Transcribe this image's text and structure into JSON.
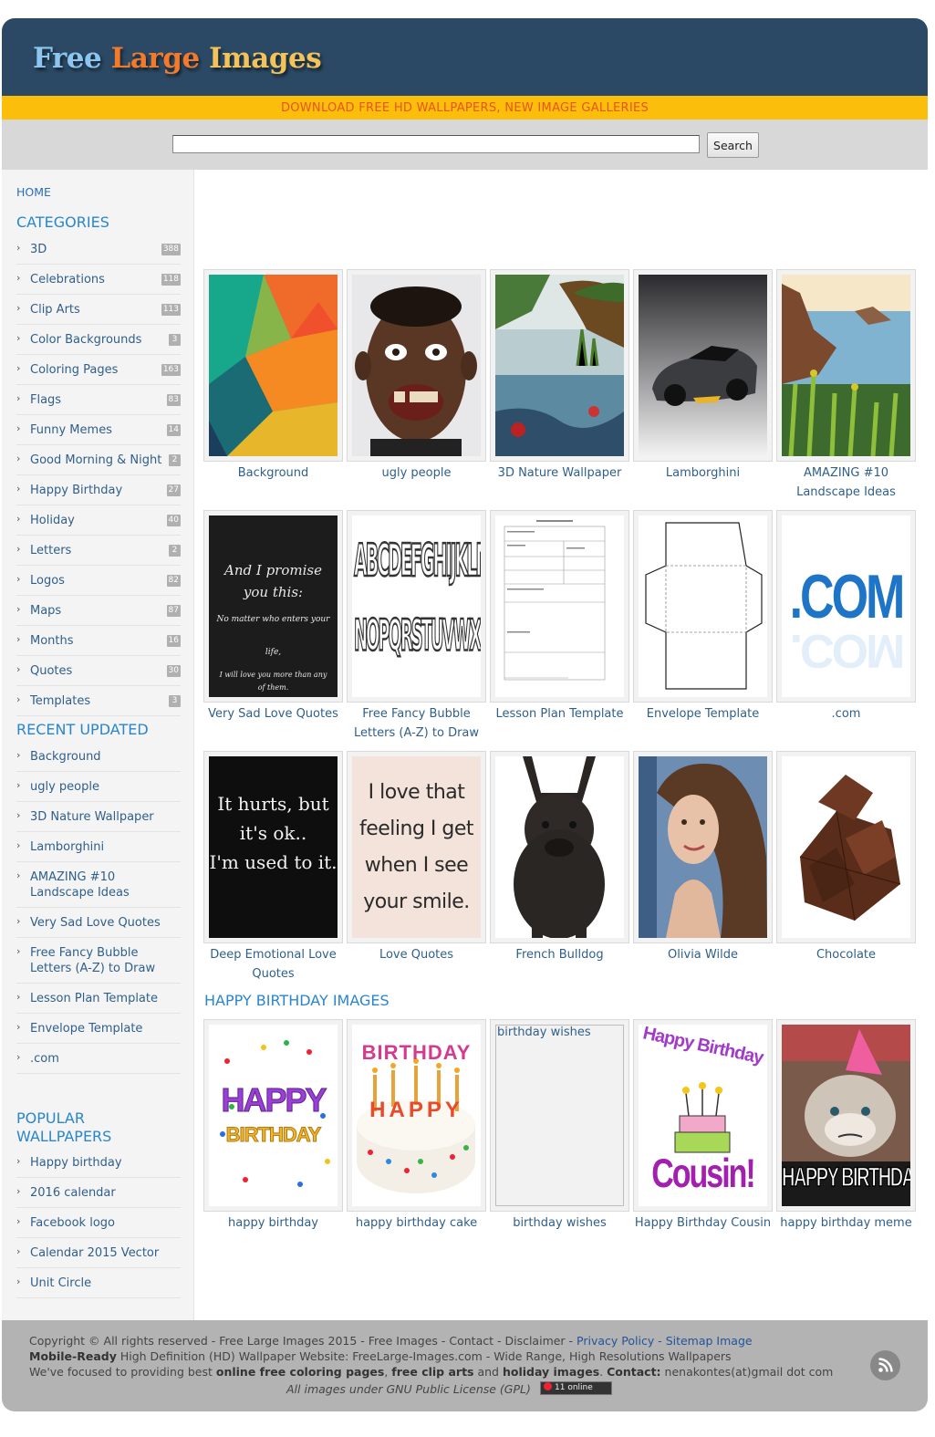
{
  "header": {
    "logo_word1": "Free",
    "logo_word2": "Large",
    "logo_word3": "Images",
    "tagline": "DOWNLOAD FREE HD WALLPAPERS, NEW IMAGE GALLERIES"
  },
  "search": {
    "value": "",
    "button_label": "Search"
  },
  "sidebar": {
    "home_label": "HOME",
    "categories_heading": "CATEGORIES",
    "categories": [
      {
        "label": "3D",
        "count": "388"
      },
      {
        "label": "Celebrations",
        "count": "118"
      },
      {
        "label": "Clip Arts",
        "count": "113"
      },
      {
        "label": "Color Backgrounds",
        "count": "3"
      },
      {
        "label": "Coloring Pages",
        "count": "163"
      },
      {
        "label": "Flags",
        "count": "83"
      },
      {
        "label": "Funny Memes",
        "count": "14"
      },
      {
        "label": "Good Morning & Night",
        "count": "2"
      },
      {
        "label": "Happy Birthday",
        "count": "27"
      },
      {
        "label": "Holiday",
        "count": "40"
      },
      {
        "label": "Letters",
        "count": "2"
      },
      {
        "label": "Logos",
        "count": "82"
      },
      {
        "label": "Maps",
        "count": "87"
      },
      {
        "label": "Months",
        "count": "16"
      },
      {
        "label": "Quotes",
        "count": "30"
      },
      {
        "label": "Templates",
        "count": "3"
      }
    ],
    "recent_heading": "RECENT UPDATED",
    "recent": [
      "Background",
      "ugly people",
      "3D Nature Wallpaper",
      "Lamborghini",
      "AMAZING #10 Landscape Ideas",
      "Very Sad Love Quotes",
      "Free Fancy Bubble Letters (A-Z) to Draw",
      "Lesson Plan Template",
      "Envelope Template",
      ".com"
    ],
    "popular_heading": "POPULAR WALLPAPERS",
    "popular": [
      "Happy birthday",
      "2016 calendar",
      "Facebook logo",
      "Calendar 2015 Vector",
      "Unit Circle"
    ]
  },
  "gallery": {
    "row1": [
      "Background",
      "ugly people",
      "3D Nature Wallpaper",
      "Lamborghini",
      "AMAZING #10 Landscape Ideas"
    ],
    "row2": [
      "Very Sad Love Quotes",
      "Free Fancy Bubble Letters (A-Z) to Draw",
      "Lesson Plan Template",
      "Envelope Template",
      ".com"
    ],
    "row3": [
      "Deep Emotional Love Quotes",
      "Love Quotes",
      "French Bulldog",
      "Olivia Wilde",
      "Chocolate"
    ],
    "quote1": [
      "And I promise you this:",
      "No matter who enters your life,",
      "I will love you more than any of them."
    ],
    "quote2": [
      "It hurts, but",
      "it's ok..",
      "I'm used to it."
    ],
    "quote3": [
      "I love that",
      "feeling I get",
      "when I see",
      "your smile."
    ],
    "alphabet1": "ABCDEFGHIJKLM",
    "alphabet2": "NOPQRSTUVWXYZ",
    "dotcom": ".COM"
  },
  "birthday": {
    "heading": "HAPPY BIRTHDAY IMAGES",
    "items": [
      "happy birthday",
      "happy birthday cake",
      "birthday wishes",
      "Happy Birthday Cousin",
      "happy birthday meme"
    ],
    "alt_text": "birthday wishes",
    "happy": "HAPPY",
    "birthday_word": "BIRTHDAY",
    "cousin_top": "Happy Birthday",
    "cousin_bottom": "Cousin!",
    "meme_text": "HAPPY BIRTHDAY"
  },
  "footer": {
    "line1": "Copyright © All rights reserved - Free Large Images 2015 - Free Images - Contact - Disclaimer - ",
    "privacy": "Privacy Policy",
    "sep": " - ",
    "sitemap": "Sitemap Image",
    "line2_bold": "Mobile-Ready",
    "line2_rest": " High Definition (HD) Wallpaper Website: FreeLarge-Images.com - Wide Range, High Resolutions Wallpapers",
    "line3_a": "We've focused to providing best ",
    "line3_b": "online free coloring pages",
    "line3_c": ", ",
    "line3_d": "free clip arts",
    "line3_e": " and ",
    "line3_f": "holiday images",
    "line3_g": ". ",
    "line3_h": "Contact:",
    "line3_i": " nenakontes(at)gmail dot com",
    "license": "All images under GNU Public License (GPL)",
    "online": "11 online"
  },
  "colors": {
    "header_bg": "#2b4964",
    "tagline_bg": "#fbbf0b",
    "tagline_text": "#e8541e",
    "link_blue": "#2a86cc",
    "footer_bg": "#b3b3b3"
  }
}
